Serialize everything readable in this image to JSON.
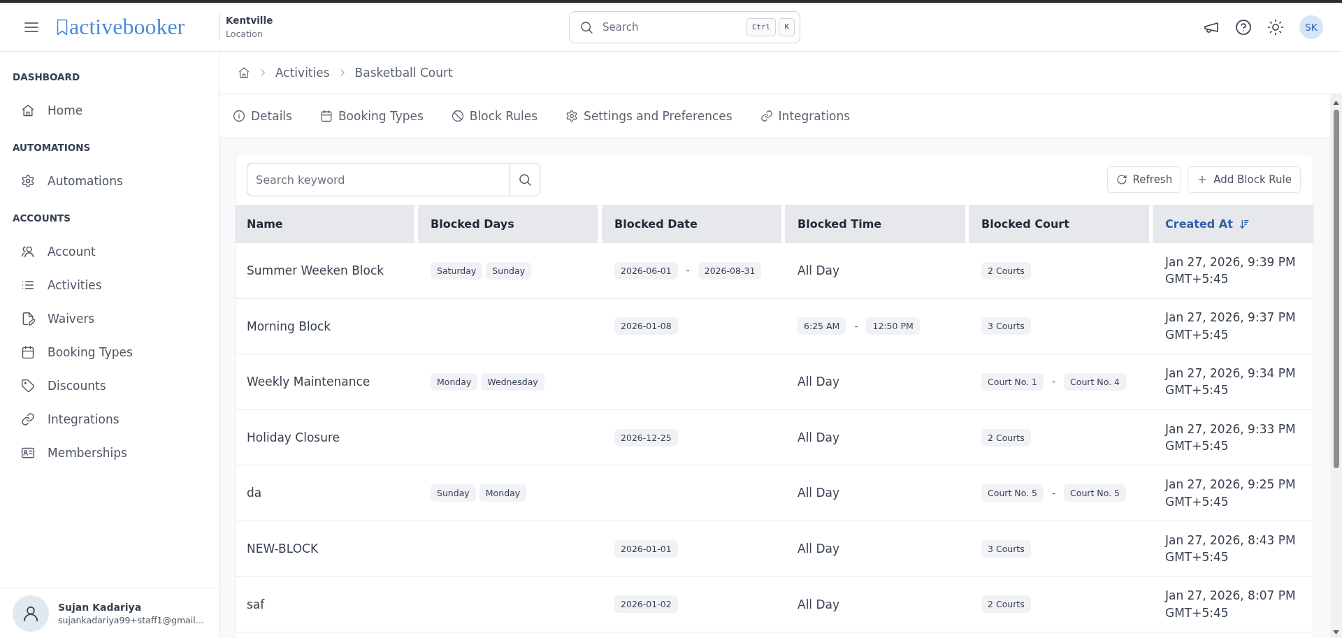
{
  "header": {
    "logo": "activebooker",
    "location": {
      "name": "Kentville",
      "label": "Location"
    },
    "search": {
      "placeholder": "Search",
      "shortcut": [
        "Ctrl",
        "K"
      ]
    },
    "user_initials": "SK"
  },
  "sidebar": {
    "sections": [
      {
        "title": "DASHBOARD",
        "items": [
          {
            "label": "Home",
            "selected": false
          }
        ]
      },
      {
        "title": "AUTOMATIONS",
        "items": [
          {
            "label": "Automations",
            "selected": false
          }
        ]
      },
      {
        "title": "ACCOUNTS",
        "items": [
          {
            "label": "Account",
            "selected": false
          },
          {
            "label": "Activities",
            "selected": false
          },
          {
            "label": "Waivers",
            "selected": false
          },
          {
            "label": "Booking Types",
            "selected": false
          },
          {
            "label": "Discounts",
            "selected": false
          },
          {
            "label": "Integrations",
            "selected": false
          },
          {
            "label": "Memberships",
            "selected": false
          }
        ]
      }
    ],
    "user": {
      "name": "Sujan Kadariya",
      "email": "sujankadariya99+staff1@gmail…"
    }
  },
  "breadcrumb": [
    "Activities",
    "Basketball Court"
  ],
  "tabs": [
    {
      "label": "Details",
      "selected": false
    },
    {
      "label": "Booking Types",
      "selected": false
    },
    {
      "label": "Block Rules",
      "selected": false
    },
    {
      "label": "Settings and Preferences",
      "selected": false
    },
    {
      "label": "Integrations",
      "selected": false
    }
  ],
  "block_rules": {
    "search": {
      "placeholder": "Search keyword"
    },
    "buttons": [
      "Refresh",
      "Add Block Rule"
    ],
    "table": {
      "columns": [
        {
          "label": "Name",
          "sorted": false
        },
        {
          "label": "Blocked Days",
          "sorted": false
        },
        {
          "label": "Blocked Date",
          "sorted": false
        },
        {
          "label": "Blocked Time",
          "sorted": false
        },
        {
          "label": "Blocked Court",
          "sorted": false
        },
        {
          "label": "Created At",
          "sorted": true
        }
      ],
      "rows": [
        {
          "name": "Summer Weeken Block",
          "blocked_days": [
            "Saturday",
            "Sunday"
          ],
          "blocked_date": {
            "kind": "range",
            "from": "2026-06-01",
            "separator": "-",
            "to": "2026-08-31"
          },
          "blocked_time": {
            "kind": "text",
            "text": "All Day"
          },
          "blocked_court": {
            "kind": "tag",
            "text": "2 Courts"
          },
          "created_at": "Jan 27, 2026, 9:39 PM\nGMT+5:45"
        },
        {
          "name": "Morning Block",
          "blocked_date": {
            "kind": "tag",
            "text": "2026-01-08"
          },
          "blocked_time": {
            "kind": "range",
            "from": "6:25 AM",
            "separator": "-",
            "to": "12:50 PM"
          },
          "blocked_court": {
            "kind": "tag",
            "text": "3 Courts"
          },
          "created_at": "Jan 27, 2026, 9:37 PM\nGMT+5:45"
        },
        {
          "name": "Weekly Maintenance",
          "blocked_days": [
            "Monday",
            "Wednesday"
          ],
          "blocked_time": {
            "kind": "text",
            "text": "All Day"
          },
          "blocked_court": {
            "kind": "range",
            "from": "Court No. 1",
            "separator": "-",
            "to": "Court No. 4"
          },
          "created_at": "Jan 27, 2026, 9:34 PM\nGMT+5:45"
        },
        {
          "name": "Holiday Closure",
          "blocked_date": {
            "kind": "tag",
            "text": "2026-12-25"
          },
          "blocked_time": {
            "kind": "text",
            "text": "All Day"
          },
          "blocked_court": {
            "kind": "tag",
            "text": "2 Courts"
          },
          "created_at": "Jan 27, 2026, 9:33 PM\nGMT+5:45"
        },
        {
          "name": "da",
          "blocked_days": [
            "Sunday",
            "Monday"
          ],
          "blocked_time": {
            "kind": "text",
            "text": "All Day"
          },
          "blocked_court": {
            "kind": "range",
            "from": "Court No. 5",
            "separator": "-",
            "to": "Court No. 5"
          },
          "created_at": "Jan 27, 2026, 9:25 PM\nGMT+5:45"
        },
        {
          "name": "NEW-BLOCK",
          "blocked_date": {
            "kind": "tag",
            "text": "2026-01-01"
          },
          "blocked_time": {
            "kind": "text",
            "text": "All Day"
          },
          "blocked_court": {
            "kind": "tag",
            "text": "3 Courts"
          },
          "created_at": "Jan 27, 2026, 8:43 PM\nGMT+5:45"
        },
        {
          "name": "saf",
          "blocked_date": {
            "kind": "tag",
            "text": "2026-01-02"
          },
          "blocked_time": {
            "kind": "text",
            "text": "All Day"
          },
          "blocked_court": {
            "kind": "tag",
            "text": "2 Courts"
          },
          "created_at": "Jan 27, 2026, 8:07 PM\nGMT+5:45"
        }
      ]
    }
  }
}
